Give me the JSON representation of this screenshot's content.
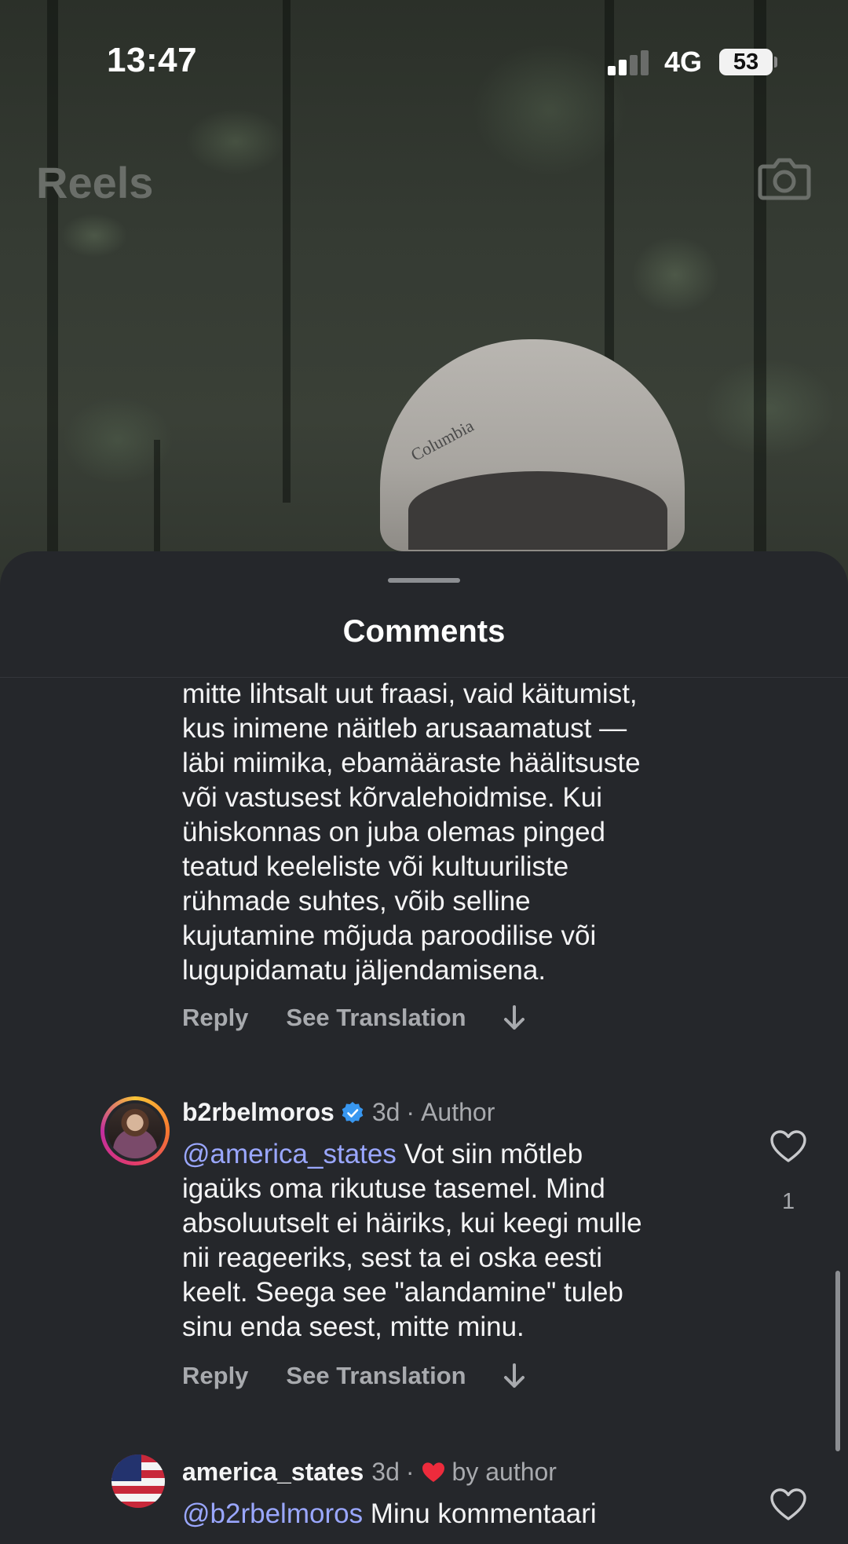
{
  "status_bar": {
    "time": "13:47",
    "network": "4G",
    "battery": "53"
  },
  "header": {
    "title": "Reels",
    "camera_icon": "camera-icon"
  },
  "reel": {
    "cap_text": "Columbia"
  },
  "sheet": {
    "title": "Comments"
  },
  "comments": [
    {
      "lines": [
        "mitte lihtsalt uut fraasi, vaid käitumist,",
        "kus inimene näitleb arusaamatust —",
        "läbi miimika, ebamääraste häälitsuste",
        "või vastusest kõrvalehoidmise. Kui",
        "ühiskonnas on juba olemas pinged",
        "teatud keeleliste või kultuuriliste",
        "rühmade suhtes, võib selline",
        "kujutamine mõjuda paroodilise või",
        "lugupidamatu jäljendamisena."
      ],
      "reply_label": "Reply",
      "translate_label": "See Translation"
    },
    {
      "username": "b2rbelmoros",
      "verified": true,
      "time": "3d",
      "badge": "Author",
      "mention": "@america_states",
      "first_line_rest": " Vot siin mõtleb",
      "lines": [
        "igaüks oma rikutuse tasemel. Mind",
        "absoluutselt ei häiriks, kui keegi mulle",
        "nii reageeriks, sest ta ei oska eesti",
        "keelt. Seega see \"alandamine\" tuleb",
        "sinu enda seest, mitte minu."
      ],
      "likes": "1",
      "reply_label": "Reply",
      "translate_label": "See Translation"
    },
    {
      "username": "america_states",
      "time": "3d",
      "liked_by": "by author",
      "mention": "@b2rbelmoros",
      "first_line_rest": " Minu kommentaari"
    }
  ],
  "colors": {
    "sheet_bg": "#25272b",
    "mention": "#9aa7ff",
    "verified": "#3897f0",
    "heart_red": "#ed2b3c",
    "secondary_text": "#a8aaae"
  }
}
